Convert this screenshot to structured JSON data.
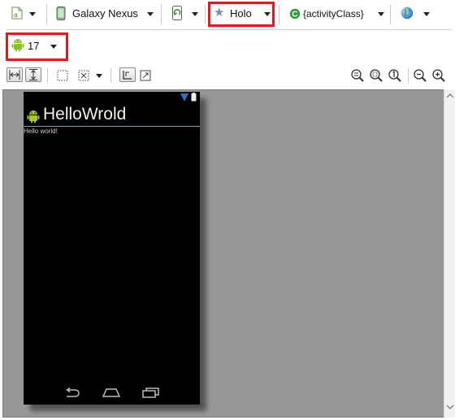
{
  "toolbar": {
    "device": "Galaxy Nexus",
    "theme": "Holo",
    "activity": "{activityClass}",
    "api_level": "17"
  },
  "app": {
    "title": "HelloWrold",
    "content_text": "Hello world!"
  },
  "colors": {
    "highlight": "#e01b1b",
    "canvas_bg": "#979797",
    "action_bar_divider": "#33b5e5"
  },
  "icons": {
    "layout_file": "layout-file-icon",
    "device": "phone-device-icon",
    "orientation": "rotate-icon",
    "theme": "star-icon",
    "activity": "class-c-icon",
    "locale": "globe-icon",
    "android": "android-robot-icon"
  }
}
